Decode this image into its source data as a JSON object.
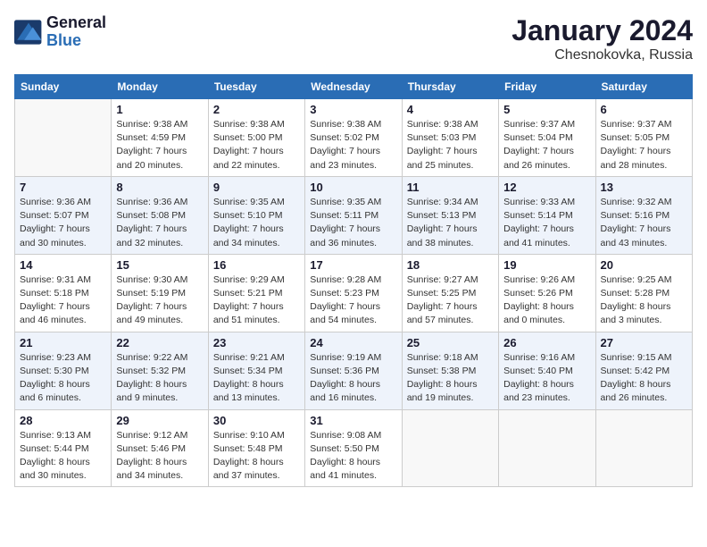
{
  "logo": {
    "line1": "General",
    "line2": "Blue"
  },
  "title": "January 2024",
  "subtitle": "Chesnokovka, Russia",
  "days_header": [
    "Sunday",
    "Monday",
    "Tuesday",
    "Wednesday",
    "Thursday",
    "Friday",
    "Saturday"
  ],
  "weeks": [
    [
      {
        "num": "",
        "detail": ""
      },
      {
        "num": "1",
        "detail": "Sunrise: 9:38 AM\nSunset: 4:59 PM\nDaylight: 7 hours\nand 20 minutes."
      },
      {
        "num": "2",
        "detail": "Sunrise: 9:38 AM\nSunset: 5:00 PM\nDaylight: 7 hours\nand 22 minutes."
      },
      {
        "num": "3",
        "detail": "Sunrise: 9:38 AM\nSunset: 5:02 PM\nDaylight: 7 hours\nand 23 minutes."
      },
      {
        "num": "4",
        "detail": "Sunrise: 9:38 AM\nSunset: 5:03 PM\nDaylight: 7 hours\nand 25 minutes."
      },
      {
        "num": "5",
        "detail": "Sunrise: 9:37 AM\nSunset: 5:04 PM\nDaylight: 7 hours\nand 26 minutes."
      },
      {
        "num": "6",
        "detail": "Sunrise: 9:37 AM\nSunset: 5:05 PM\nDaylight: 7 hours\nand 28 minutes."
      }
    ],
    [
      {
        "num": "7",
        "detail": "Sunrise: 9:36 AM\nSunset: 5:07 PM\nDaylight: 7 hours\nand 30 minutes."
      },
      {
        "num": "8",
        "detail": "Sunrise: 9:36 AM\nSunset: 5:08 PM\nDaylight: 7 hours\nand 32 minutes."
      },
      {
        "num": "9",
        "detail": "Sunrise: 9:35 AM\nSunset: 5:10 PM\nDaylight: 7 hours\nand 34 minutes."
      },
      {
        "num": "10",
        "detail": "Sunrise: 9:35 AM\nSunset: 5:11 PM\nDaylight: 7 hours\nand 36 minutes."
      },
      {
        "num": "11",
        "detail": "Sunrise: 9:34 AM\nSunset: 5:13 PM\nDaylight: 7 hours\nand 38 minutes."
      },
      {
        "num": "12",
        "detail": "Sunrise: 9:33 AM\nSunset: 5:14 PM\nDaylight: 7 hours\nand 41 minutes."
      },
      {
        "num": "13",
        "detail": "Sunrise: 9:32 AM\nSunset: 5:16 PM\nDaylight: 7 hours\nand 43 minutes."
      }
    ],
    [
      {
        "num": "14",
        "detail": "Sunrise: 9:31 AM\nSunset: 5:18 PM\nDaylight: 7 hours\nand 46 minutes."
      },
      {
        "num": "15",
        "detail": "Sunrise: 9:30 AM\nSunset: 5:19 PM\nDaylight: 7 hours\nand 49 minutes."
      },
      {
        "num": "16",
        "detail": "Sunrise: 9:29 AM\nSunset: 5:21 PM\nDaylight: 7 hours\nand 51 minutes."
      },
      {
        "num": "17",
        "detail": "Sunrise: 9:28 AM\nSunset: 5:23 PM\nDaylight: 7 hours\nand 54 minutes."
      },
      {
        "num": "18",
        "detail": "Sunrise: 9:27 AM\nSunset: 5:25 PM\nDaylight: 7 hours\nand 57 minutes."
      },
      {
        "num": "19",
        "detail": "Sunrise: 9:26 AM\nSunset: 5:26 PM\nDaylight: 8 hours\nand 0 minutes."
      },
      {
        "num": "20",
        "detail": "Sunrise: 9:25 AM\nSunset: 5:28 PM\nDaylight: 8 hours\nand 3 minutes."
      }
    ],
    [
      {
        "num": "21",
        "detail": "Sunrise: 9:23 AM\nSunset: 5:30 PM\nDaylight: 8 hours\nand 6 minutes."
      },
      {
        "num": "22",
        "detail": "Sunrise: 9:22 AM\nSunset: 5:32 PM\nDaylight: 8 hours\nand 9 minutes."
      },
      {
        "num": "23",
        "detail": "Sunrise: 9:21 AM\nSunset: 5:34 PM\nDaylight: 8 hours\nand 13 minutes."
      },
      {
        "num": "24",
        "detail": "Sunrise: 9:19 AM\nSunset: 5:36 PM\nDaylight: 8 hours\nand 16 minutes."
      },
      {
        "num": "25",
        "detail": "Sunrise: 9:18 AM\nSunset: 5:38 PM\nDaylight: 8 hours\nand 19 minutes."
      },
      {
        "num": "26",
        "detail": "Sunrise: 9:16 AM\nSunset: 5:40 PM\nDaylight: 8 hours\nand 23 minutes."
      },
      {
        "num": "27",
        "detail": "Sunrise: 9:15 AM\nSunset: 5:42 PM\nDaylight: 8 hours\nand 26 minutes."
      }
    ],
    [
      {
        "num": "28",
        "detail": "Sunrise: 9:13 AM\nSunset: 5:44 PM\nDaylight: 8 hours\nand 30 minutes."
      },
      {
        "num": "29",
        "detail": "Sunrise: 9:12 AM\nSunset: 5:46 PM\nDaylight: 8 hours\nand 34 minutes."
      },
      {
        "num": "30",
        "detail": "Sunrise: 9:10 AM\nSunset: 5:48 PM\nDaylight: 8 hours\nand 37 minutes."
      },
      {
        "num": "31",
        "detail": "Sunrise: 9:08 AM\nSunset: 5:50 PM\nDaylight: 8 hours\nand 41 minutes."
      },
      {
        "num": "",
        "detail": ""
      },
      {
        "num": "",
        "detail": ""
      },
      {
        "num": "",
        "detail": ""
      }
    ]
  ]
}
